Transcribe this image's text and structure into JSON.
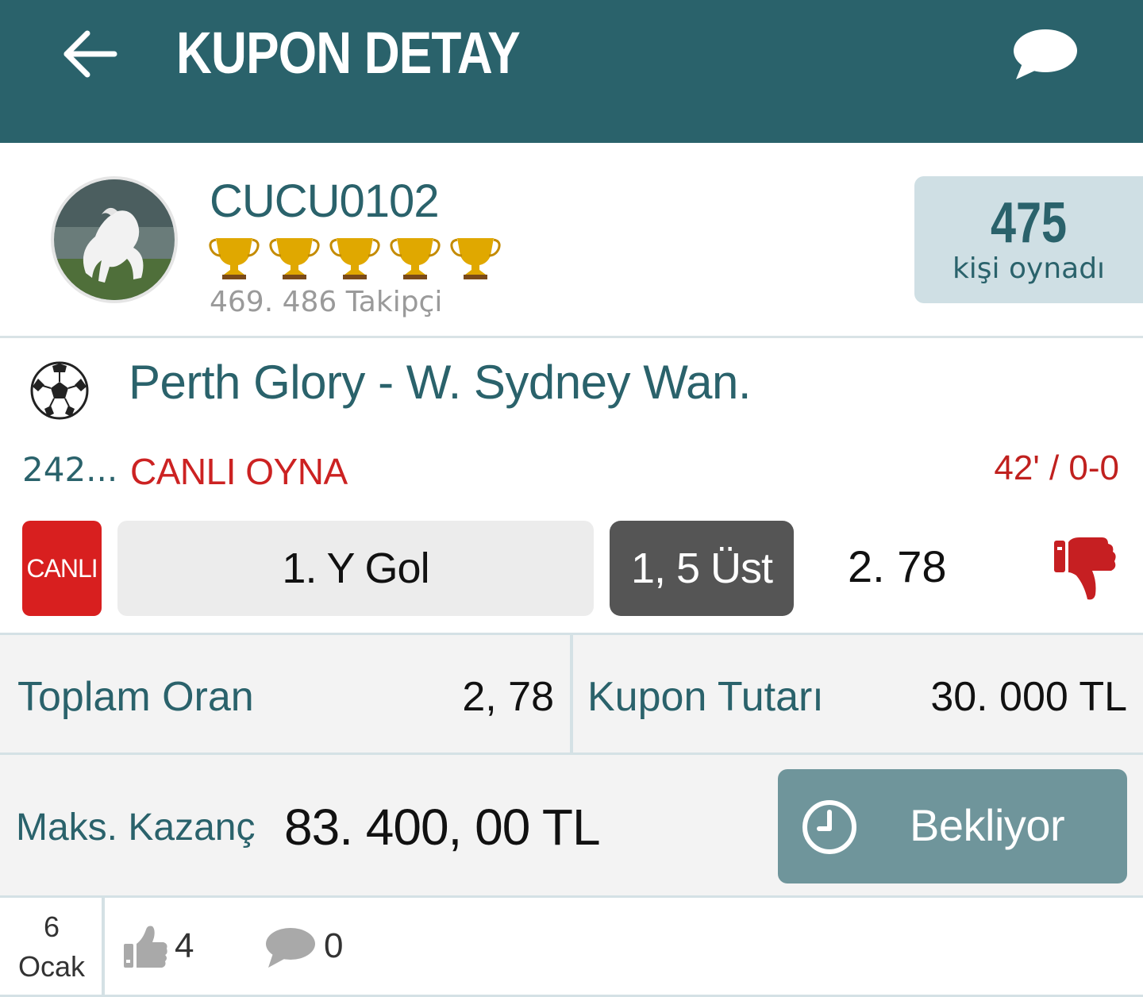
{
  "header": {
    "title": "KUPON DETAY",
    "back_icon": "arrow-left-icon",
    "chat_icon": "chat-bubble-icon",
    "bg_color": "#2a626b"
  },
  "profile": {
    "username": "CUCU0102",
    "trophy_count": 5,
    "followers": "469. 486 Takipçi",
    "played_count": "475",
    "played_label": "kişi oynadı"
  },
  "match": {
    "sport_icon": "soccer-ball-icon",
    "teams": "Perth Glory - W.  Sydney Wan.",
    "code": "242...",
    "live_play": "CANLI OYNA",
    "live_status": "42' / 0-0",
    "live_badge": "CANLI",
    "bet_type": "1. Y Gol",
    "bet_pick": "1, 5 Üst",
    "odds": "2. 78",
    "result_icon": "thumbs-down-icon",
    "live_color": "#d81f1f"
  },
  "totals": {
    "total_odds_label": "Toplam Oran",
    "total_odds": "2, 78",
    "stake_label": "Kupon Tutarı",
    "stake": "30. 000 TL"
  },
  "max_win": {
    "label": "Maks.  Kazanç",
    "value": "83. 400, 00 TL",
    "status_label": "Bekliyor",
    "status_icon": "clock-icon"
  },
  "footer": {
    "day": "6",
    "month": "Ocak",
    "likes": "4",
    "comments": "0"
  }
}
